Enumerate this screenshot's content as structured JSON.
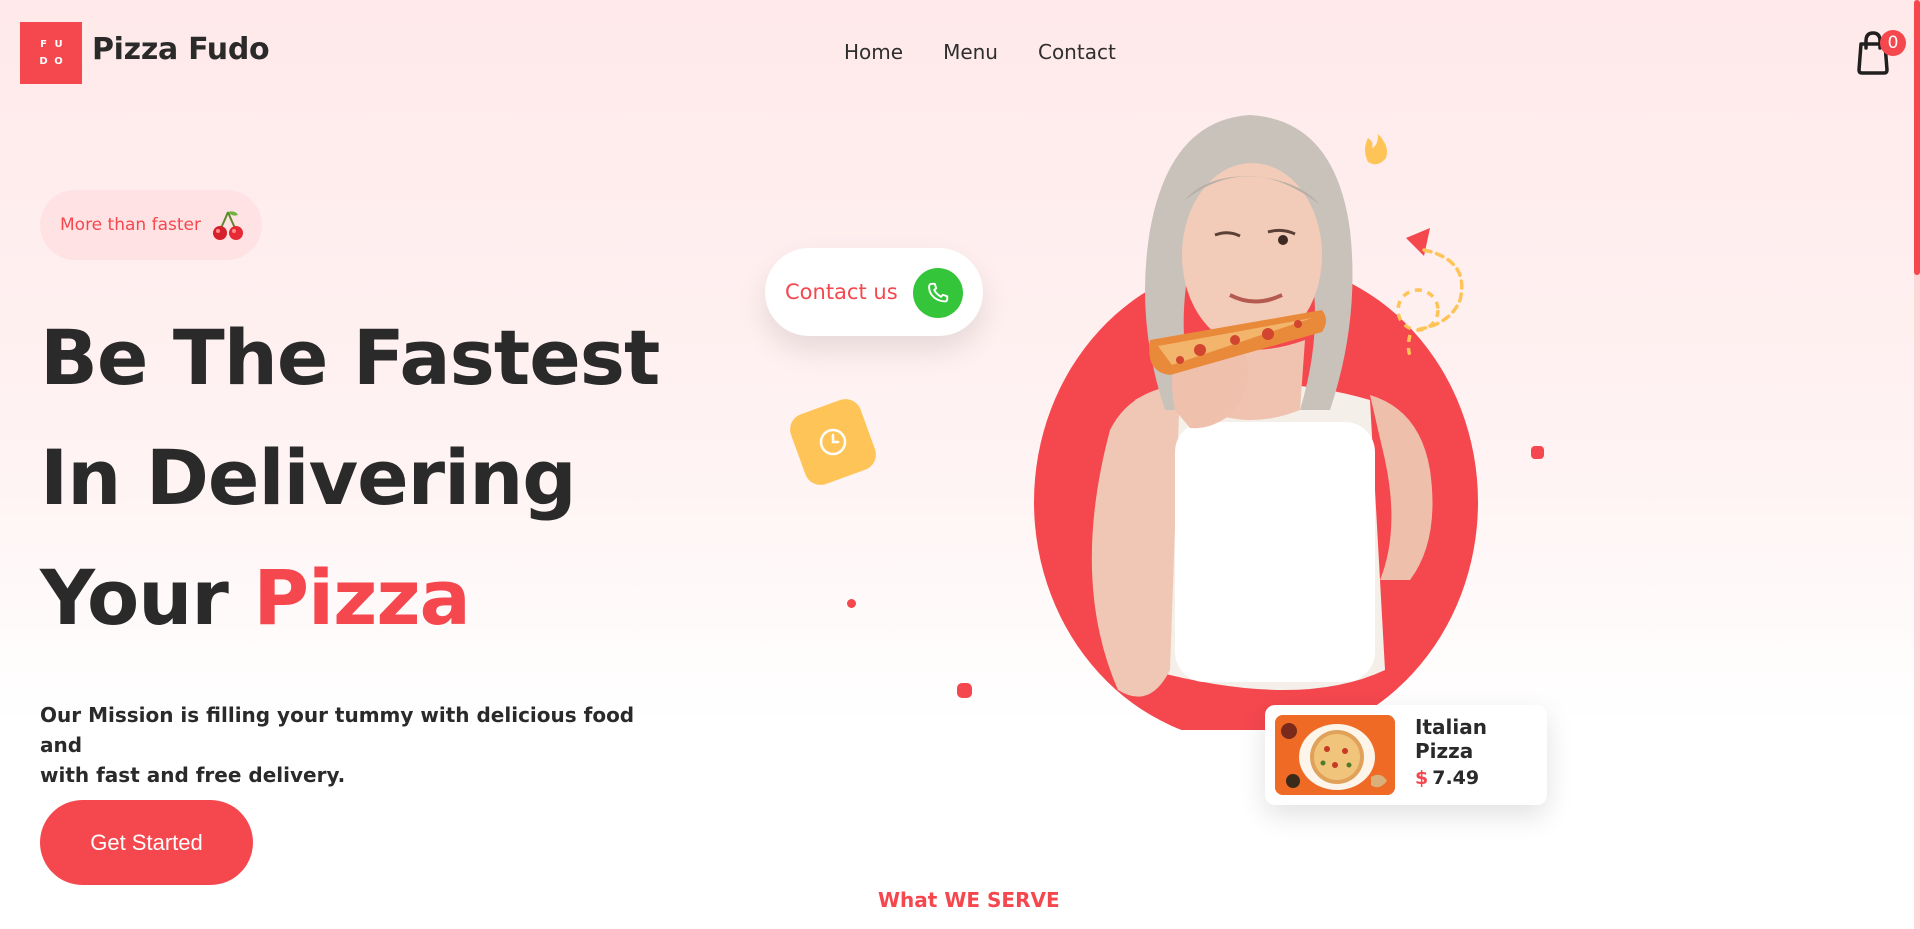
{
  "header": {
    "logo_letters": [
      "F",
      "U",
      "D",
      "O"
    ],
    "brand": "Pizza Fudo",
    "nav": [
      {
        "label": "Home"
      },
      {
        "label": "Menu"
      },
      {
        "label": "Contact"
      }
    ],
    "cart_count": "0"
  },
  "hero": {
    "tagline": "More than faster",
    "headline_line1": "Be The Fastest",
    "headline_line2": "In Delivering",
    "headline_line3_prefix": "Your",
    "headline_line3_accent": "Pizza",
    "mission_line1": "Our Mission is filling your tummy with delicious food and",
    "mission_line2": "with fast and free delivery.",
    "cta_label": "Get Started",
    "contact_label": "Contact us",
    "food_card": {
      "name": "Italian Pizza",
      "currency": "$",
      "price": "7.49"
    }
  },
  "section_label": "What WE SERVE",
  "colors": {
    "accent": "#f5474e",
    "phone_green": "#35c53a",
    "clock_yellow": "#ffc457",
    "text_dark": "#2a2a2a"
  },
  "icons": [
    "cart-icon",
    "cherry-icon",
    "phone-icon",
    "clock-icon",
    "flame-icon"
  ]
}
